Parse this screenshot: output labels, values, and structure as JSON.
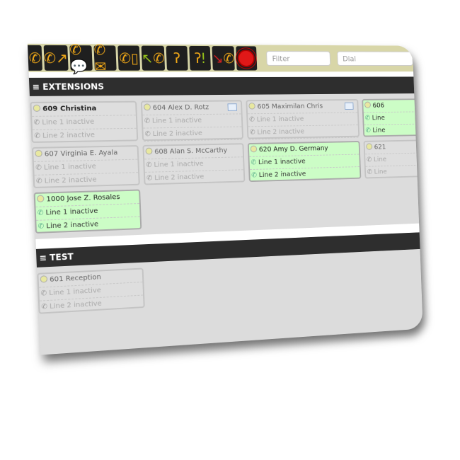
{
  "toolbar": {
    "buttons": [
      {
        "icon": "phone-icon"
      },
      {
        "icon": "transfer-icon"
      },
      {
        "icon": "chat-transfer-icon"
      },
      {
        "icon": "mail-transfer-icon"
      },
      {
        "icon": "mobile-transfer-icon"
      },
      {
        "icon": "pickup-icon"
      },
      {
        "icon": "listen-icon"
      },
      {
        "icon": "whisper-icon"
      },
      {
        "icon": "hangup-icon"
      },
      {
        "icon": "record-stop-icon"
      }
    ],
    "filter_placeholder": "Filter",
    "dial_placeholder": "Dial"
  },
  "sections": [
    {
      "title": "EXTENSIONS",
      "cards": [
        {
          "name": "609 Christina",
          "line1": "Line 1 inactive",
          "line2": "Line 2 inactive",
          "active": false
        },
        {
          "name": "604 Alex D. Rotz",
          "line1": "Line 1 inactive",
          "line2": "Line 2 inactive",
          "active": false,
          "mail": true
        },
        {
          "name": "605 Maximilan Chris",
          "line1": "Line 1 inactive",
          "line2": "Line 2 inactive",
          "active": false,
          "mail": true
        },
        {
          "name": "606",
          "line1": "Line",
          "line2": "Line",
          "active": true
        },
        {
          "name": "607 Virginia E. Ayala",
          "line1": "Line 1 inactive",
          "line2": "Line 2 inactive",
          "active": false
        },
        {
          "name": "608 Alan S. McCarthy",
          "line1": "Line 1 inactive",
          "line2": "Line 2 inactive",
          "active": false
        },
        {
          "name": "620 Amy D. Germany",
          "line1": "Line 1 inactive",
          "line2": "Line 2 inactive",
          "active": true
        },
        {
          "name": "621",
          "line1": "Line",
          "line2": "Line",
          "active": false
        },
        {
          "name": "1000 Jose Z. Rosales",
          "line1": "Line 1 inactive",
          "line2": "Line 2 inactive",
          "active": true
        }
      ]
    },
    {
      "title": "TEST",
      "cards": [
        {
          "name": "601 Reception",
          "line1": "Line 1 inactive",
          "line2": "Line 2 inactive",
          "active": false
        }
      ]
    }
  ],
  "colors": {
    "active_card": "#ccfdc6",
    "toolbar_icon": "#f0a818",
    "section_bar": "#2e2e2e"
  }
}
